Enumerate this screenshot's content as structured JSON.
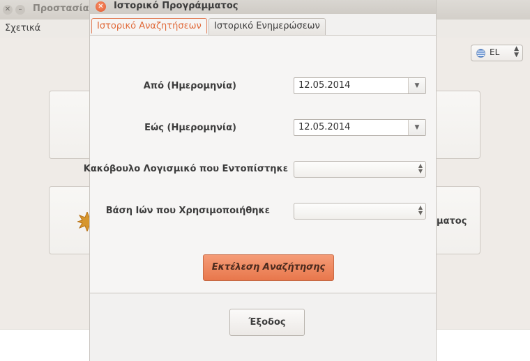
{
  "background_window": {
    "title": "Προστασία",
    "menu": {
      "about": "Σχετικά"
    },
    "language": {
      "value": "EL",
      "flag_icon": "greek-flag-icon"
    },
    "card_partial_label": "ματος"
  },
  "dialog": {
    "title": "Ιστορικό Προγράμματος",
    "close_icon": "close-icon",
    "tabs": [
      {
        "label": "Ιστορικό Αναζητήσεων",
        "active": true
      },
      {
        "label": "Ιστορικό Ενημερώσεων",
        "active": false
      }
    ],
    "form": {
      "from_label": "Από (Ημερομηνία)",
      "from_value": "12.05.2014",
      "to_label": "Εώς (Ημερομηνία)",
      "to_value": "12.05.2014",
      "malware_label": "Κακόβουλο Λογισμικό που Εντοπίστηκε",
      "malware_value": "",
      "db_label": "Βάση Ιών που Χρησιμοποιήθηκε",
      "db_value": ""
    },
    "run_search_label": "Εκτέλεση Αναζήτησης",
    "exit_label": "Έξοδος"
  },
  "colors": {
    "accent": "#e8774c",
    "tab_active": "#e06a3a",
    "window_bg": "#efebe7"
  }
}
